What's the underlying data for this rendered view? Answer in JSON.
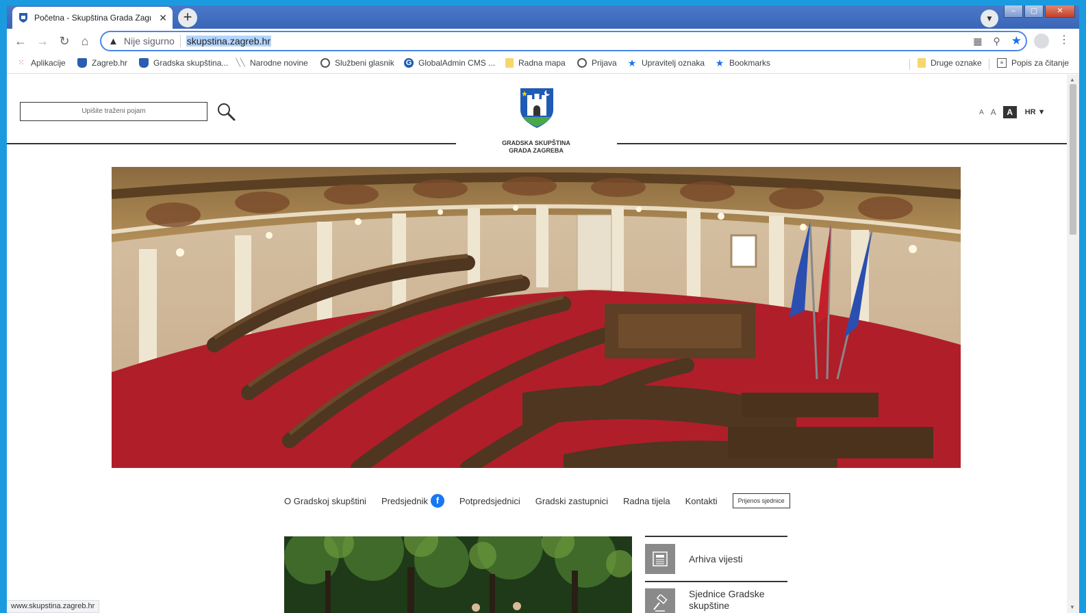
{
  "browser": {
    "tab_title": "Početna - Skupština Grada Zagre",
    "tab_close": "✕",
    "new_tab": "+",
    "security_label": "Nije sigurno",
    "url": "skupstina.zagreb.hr",
    "status_url": "www.skupstina.zagreb.hr",
    "window_controls": [
      "–",
      "▢",
      "✕"
    ]
  },
  "bookmarks": {
    "items": [
      {
        "label": "Aplikacije",
        "icon": "apps-grid-icon"
      },
      {
        "label": "Zagreb.hr",
        "icon": "zagreb-crest-icon"
      },
      {
        "label": "Gradska skupština...",
        "icon": "zagreb-crest-icon"
      },
      {
        "label": "Narodne novine",
        "icon": "nn-icon"
      },
      {
        "label": "Službeni glasnik",
        "icon": "globe-icon"
      },
      {
        "label": "GlobalAdmin CMS ...",
        "icon": "globaladmin-icon"
      },
      {
        "label": "Radna mapa",
        "icon": "folder-icon"
      },
      {
        "label": "Prijava",
        "icon": "globe-icon"
      },
      {
        "label": "Upravitelj oznaka",
        "icon": "star-icon"
      },
      {
        "label": "Bookmarks",
        "icon": "star-icon"
      }
    ],
    "other_bookmarks": "Druge oznake",
    "reading_list": "Popis za čitanje"
  },
  "header": {
    "search_placeholder": "Upišite traženi pojam",
    "logo_line1": "GRADSKA SKUPŠTINA",
    "logo_line2": "GRADA ZAGREBA",
    "font_sizes": [
      "A",
      "A",
      "A"
    ],
    "language": "HR"
  },
  "nav": {
    "items": [
      "O Gradskoj skupštini",
      "Predsjednik",
      "Potpredsjednici",
      "Gradski zastupnici",
      "Radna tijela",
      "Kontakti"
    ],
    "stream_button": "Prijenos sjednice",
    "facebook_letter": "f"
  },
  "sidebar": {
    "items": [
      {
        "label": "Arhiva vijesti",
        "icon": "newspaper-icon"
      },
      {
        "label": "Sjednice Gradske skupštine",
        "icon": "gavel-icon"
      }
    ]
  },
  "colors": {
    "accent": "#1a73e8",
    "facebook": "#1877f2",
    "carpet": "#b01e2a",
    "wood": "#4e3621"
  }
}
